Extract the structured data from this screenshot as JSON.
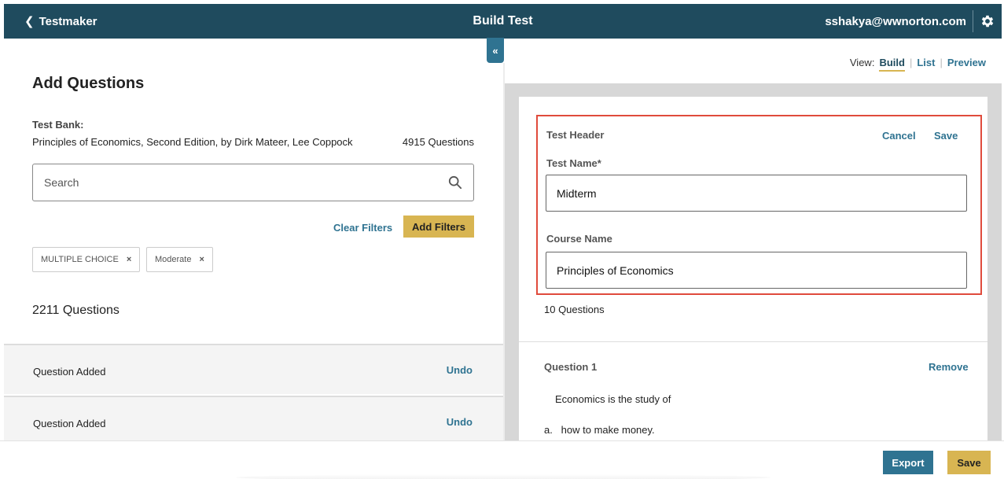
{
  "header": {
    "back_label": "Testmaker",
    "title": "Build Test",
    "user_email": "sshakya@wwnorton.com"
  },
  "left": {
    "heading": "Add Questions",
    "test_bank_label": "Test Bank:",
    "test_bank_name": "Principles of Economics, Second Edition, by Dirk Mateer, Lee Coppock",
    "test_bank_count": "4915 Questions",
    "search_placeholder": "Search",
    "clear_filters": "Clear Filters",
    "add_filters": "Add Filters",
    "filters": [
      "MULTIPLE CHOICE",
      "Moderate"
    ],
    "filter_remove_glyph": "×",
    "question_count": "2211 Questions",
    "rows": [
      {
        "label": "Question Added",
        "action": "Undo"
      },
      {
        "label": "Question Added",
        "action": "Undo"
      }
    ],
    "collapse_glyph": "«"
  },
  "right": {
    "view_label": "View:",
    "views": [
      "Build",
      "List",
      "Preview"
    ],
    "active_view": "Build",
    "test_header": {
      "title": "Test Header",
      "cancel": "Cancel",
      "save": "Save",
      "test_name_label": "Test Name*",
      "test_name_value": "Midterm",
      "course_name_label": "Course Name",
      "course_name_value": "Principles of Economics"
    },
    "questions_count": "10 Questions",
    "question": {
      "title": "Question 1",
      "remove": "Remove",
      "text": "Economics is the study of",
      "option_a": "a.   how to make money."
    }
  },
  "footer": {
    "export": "Export",
    "save": "Save"
  },
  "colors": {
    "topbar": "#1f4b5e",
    "link": "#2f7391",
    "accent_gold": "#d8b552",
    "highlight_border": "#e04b3c"
  },
  "icons": {
    "back": "chevron-left-icon",
    "settings": "gear-icon",
    "search": "search-icon",
    "collapse": "double-chevron-left-icon",
    "filter_remove": "close-icon"
  }
}
